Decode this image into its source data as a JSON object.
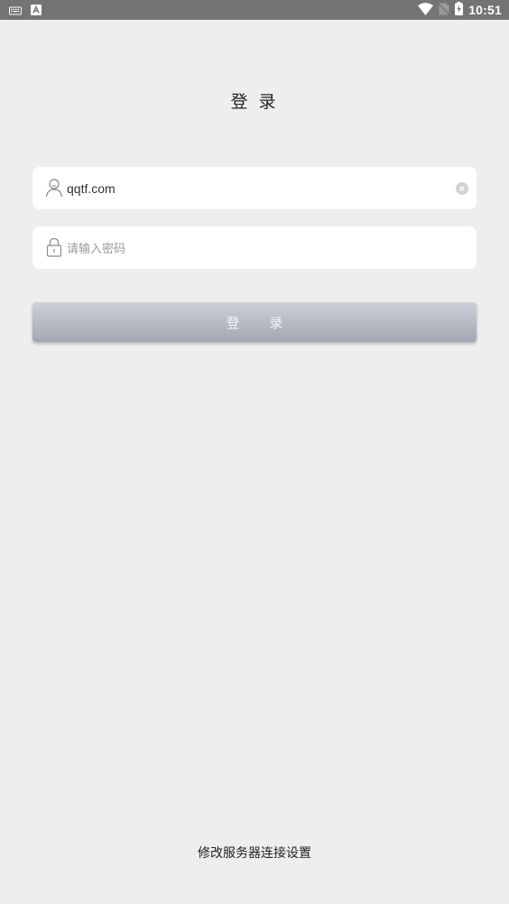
{
  "status_bar": {
    "time": "10:51",
    "icons": [
      "keyboard-icon",
      "input-method-icon",
      "wifi-icon",
      "no-sim-icon",
      "battery-charging-icon"
    ]
  },
  "page": {
    "title": "登 录"
  },
  "form": {
    "username": {
      "value": "qqtf.com",
      "icon": "user-icon",
      "clear_icon": "clear-icon"
    },
    "password": {
      "value": "",
      "placeholder": "请输入密码",
      "icon": "lock-icon"
    },
    "login_label": "登 录"
  },
  "footer": {
    "server_settings_label": "修改服务器连接设置"
  },
  "colors": {
    "background": "#eeeeee",
    "status_bar": "#747474",
    "field_background": "#ffffff",
    "button_gradient_top": "#ced0d7",
    "button_gradient_bottom": "#a3a7b1",
    "button_text": "#f4f4f6"
  }
}
